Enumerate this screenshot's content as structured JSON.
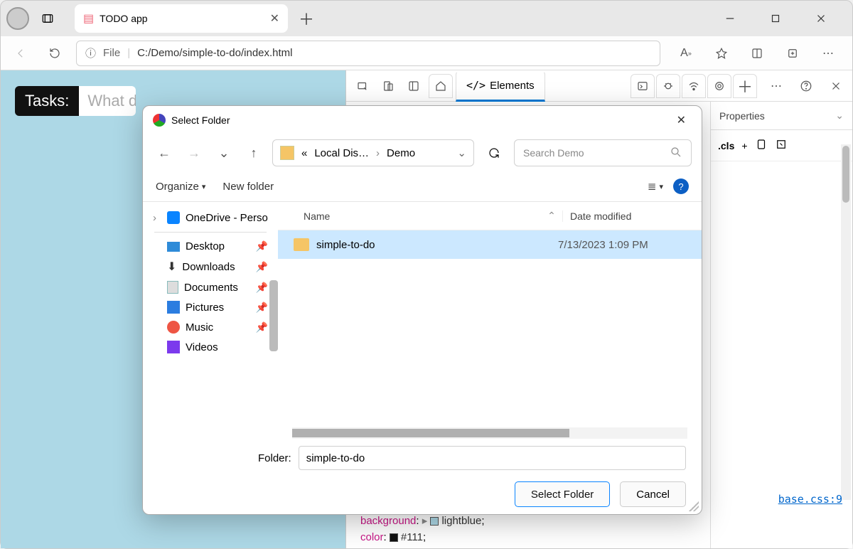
{
  "browser": {
    "tab_title": "TODO app",
    "url_scheme": "File",
    "url_path": "C:/Demo/simple-to-do/index.html"
  },
  "page": {
    "tasks_label": "Tasks:",
    "tasks_placeholder": "What do"
  },
  "devtools": {
    "elements_tab": "Elements",
    "side_tab": "Properties",
    "cls_label": ".cls",
    "link": "base.css:9",
    "code": {
      "bg_key": "background",
      "bg_val": "lightblue",
      "color_key": "color",
      "color_val": "#111"
    }
  },
  "dialog": {
    "title": "Select Folder",
    "breadcrumb": {
      "one": "«",
      "two": "Local Dis…",
      "three": "Demo"
    },
    "search_placeholder": "Search Demo",
    "organize": "Organize",
    "new_folder": "New folder",
    "tree": {
      "onedrive": "OneDrive - Perso",
      "desktop": "Desktop",
      "downloads": "Downloads",
      "documents": "Documents",
      "pictures": "Pictures",
      "music": "Music",
      "videos": "Videos"
    },
    "columns": {
      "name": "Name",
      "date": "Date modified"
    },
    "row": {
      "name": "simple-to-do",
      "date": "7/13/2023 1:09 PM"
    },
    "folder_label": "Folder:",
    "folder_value": "simple-to-do",
    "select_btn": "Select Folder",
    "cancel_btn": "Cancel"
  }
}
